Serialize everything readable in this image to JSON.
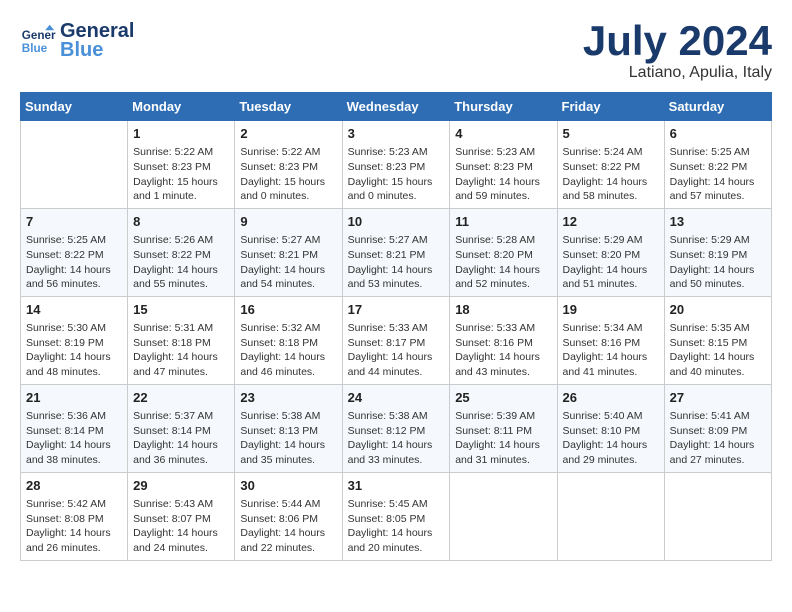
{
  "header": {
    "logo_line1": "General",
    "logo_line2": "Blue",
    "month": "July 2024",
    "location": "Latiano, Apulia, Italy"
  },
  "days_of_week": [
    "Sunday",
    "Monday",
    "Tuesday",
    "Wednesday",
    "Thursday",
    "Friday",
    "Saturday"
  ],
  "weeks": [
    [
      {
        "day": "",
        "info": ""
      },
      {
        "day": "1",
        "info": "Sunrise: 5:22 AM\nSunset: 8:23 PM\nDaylight: 15 hours\nand 1 minute."
      },
      {
        "day": "2",
        "info": "Sunrise: 5:22 AM\nSunset: 8:23 PM\nDaylight: 15 hours\nand 0 minutes."
      },
      {
        "day": "3",
        "info": "Sunrise: 5:23 AM\nSunset: 8:23 PM\nDaylight: 15 hours\nand 0 minutes."
      },
      {
        "day": "4",
        "info": "Sunrise: 5:23 AM\nSunset: 8:23 PM\nDaylight: 14 hours\nand 59 minutes."
      },
      {
        "day": "5",
        "info": "Sunrise: 5:24 AM\nSunset: 8:22 PM\nDaylight: 14 hours\nand 58 minutes."
      },
      {
        "day": "6",
        "info": "Sunrise: 5:25 AM\nSunset: 8:22 PM\nDaylight: 14 hours\nand 57 minutes."
      }
    ],
    [
      {
        "day": "7",
        "info": "Sunrise: 5:25 AM\nSunset: 8:22 PM\nDaylight: 14 hours\nand 56 minutes."
      },
      {
        "day": "8",
        "info": "Sunrise: 5:26 AM\nSunset: 8:22 PM\nDaylight: 14 hours\nand 55 minutes."
      },
      {
        "day": "9",
        "info": "Sunrise: 5:27 AM\nSunset: 8:21 PM\nDaylight: 14 hours\nand 54 minutes."
      },
      {
        "day": "10",
        "info": "Sunrise: 5:27 AM\nSunset: 8:21 PM\nDaylight: 14 hours\nand 53 minutes."
      },
      {
        "day": "11",
        "info": "Sunrise: 5:28 AM\nSunset: 8:20 PM\nDaylight: 14 hours\nand 52 minutes."
      },
      {
        "day": "12",
        "info": "Sunrise: 5:29 AM\nSunset: 8:20 PM\nDaylight: 14 hours\nand 51 minutes."
      },
      {
        "day": "13",
        "info": "Sunrise: 5:29 AM\nSunset: 8:19 PM\nDaylight: 14 hours\nand 50 minutes."
      }
    ],
    [
      {
        "day": "14",
        "info": "Sunrise: 5:30 AM\nSunset: 8:19 PM\nDaylight: 14 hours\nand 48 minutes."
      },
      {
        "day": "15",
        "info": "Sunrise: 5:31 AM\nSunset: 8:18 PM\nDaylight: 14 hours\nand 47 minutes."
      },
      {
        "day": "16",
        "info": "Sunrise: 5:32 AM\nSunset: 8:18 PM\nDaylight: 14 hours\nand 46 minutes."
      },
      {
        "day": "17",
        "info": "Sunrise: 5:33 AM\nSunset: 8:17 PM\nDaylight: 14 hours\nand 44 minutes."
      },
      {
        "day": "18",
        "info": "Sunrise: 5:33 AM\nSunset: 8:16 PM\nDaylight: 14 hours\nand 43 minutes."
      },
      {
        "day": "19",
        "info": "Sunrise: 5:34 AM\nSunset: 8:16 PM\nDaylight: 14 hours\nand 41 minutes."
      },
      {
        "day": "20",
        "info": "Sunrise: 5:35 AM\nSunset: 8:15 PM\nDaylight: 14 hours\nand 40 minutes."
      }
    ],
    [
      {
        "day": "21",
        "info": "Sunrise: 5:36 AM\nSunset: 8:14 PM\nDaylight: 14 hours\nand 38 minutes."
      },
      {
        "day": "22",
        "info": "Sunrise: 5:37 AM\nSunset: 8:14 PM\nDaylight: 14 hours\nand 36 minutes."
      },
      {
        "day": "23",
        "info": "Sunrise: 5:38 AM\nSunset: 8:13 PM\nDaylight: 14 hours\nand 35 minutes."
      },
      {
        "day": "24",
        "info": "Sunrise: 5:38 AM\nSunset: 8:12 PM\nDaylight: 14 hours\nand 33 minutes."
      },
      {
        "day": "25",
        "info": "Sunrise: 5:39 AM\nSunset: 8:11 PM\nDaylight: 14 hours\nand 31 minutes."
      },
      {
        "day": "26",
        "info": "Sunrise: 5:40 AM\nSunset: 8:10 PM\nDaylight: 14 hours\nand 29 minutes."
      },
      {
        "day": "27",
        "info": "Sunrise: 5:41 AM\nSunset: 8:09 PM\nDaylight: 14 hours\nand 27 minutes."
      }
    ],
    [
      {
        "day": "28",
        "info": "Sunrise: 5:42 AM\nSunset: 8:08 PM\nDaylight: 14 hours\nand 26 minutes."
      },
      {
        "day": "29",
        "info": "Sunrise: 5:43 AM\nSunset: 8:07 PM\nDaylight: 14 hours\nand 24 minutes."
      },
      {
        "day": "30",
        "info": "Sunrise: 5:44 AM\nSunset: 8:06 PM\nDaylight: 14 hours\nand 22 minutes."
      },
      {
        "day": "31",
        "info": "Sunrise: 5:45 AM\nSunset: 8:05 PM\nDaylight: 14 hours\nand 20 minutes."
      },
      {
        "day": "",
        "info": ""
      },
      {
        "day": "",
        "info": ""
      },
      {
        "day": "",
        "info": ""
      }
    ]
  ]
}
